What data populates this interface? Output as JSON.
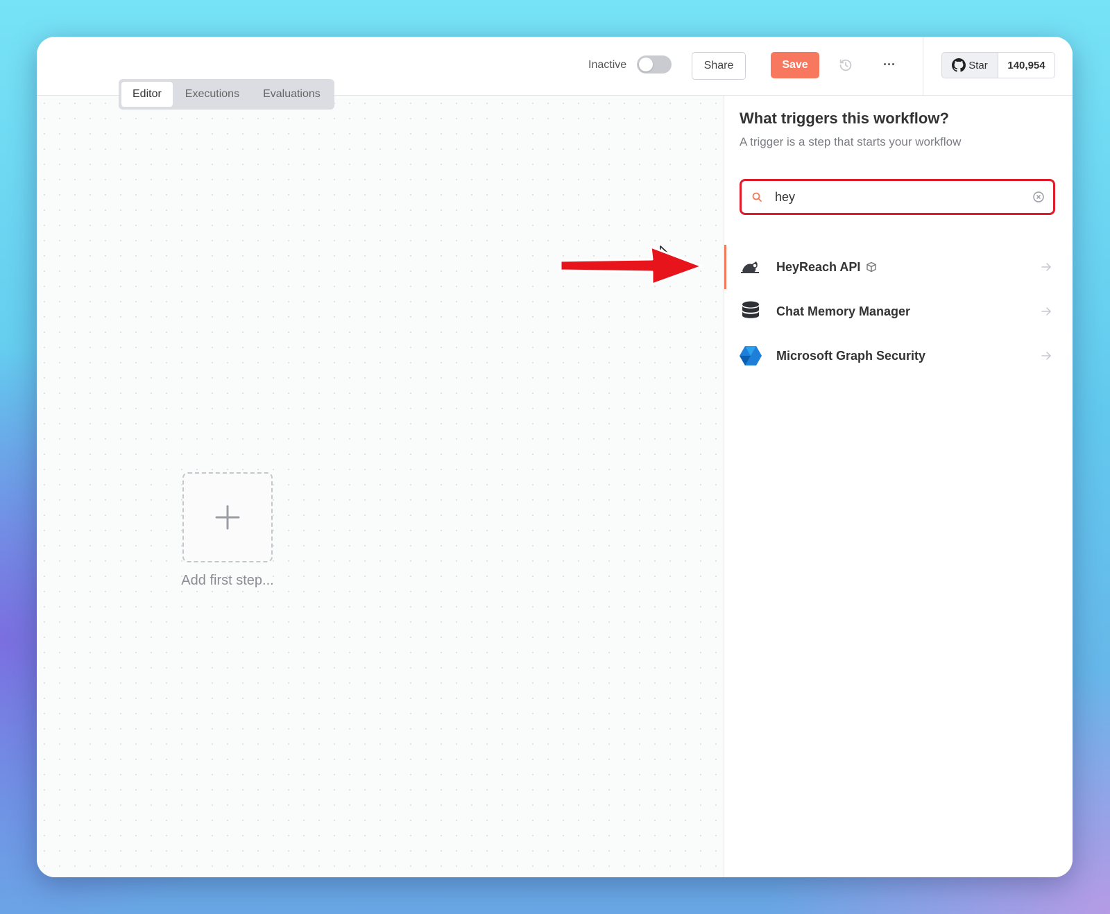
{
  "header": {
    "status_label": "Inactive",
    "share_label": "Share",
    "save_label": "Save",
    "github": {
      "star_label": "Star",
      "count": "140,954"
    }
  },
  "tabs": [
    {
      "label": "Editor",
      "active": true
    },
    {
      "label": "Executions",
      "active": false
    },
    {
      "label": "Evaluations",
      "active": false
    }
  ],
  "canvas": {
    "add_label": "Add first step..."
  },
  "panel": {
    "title": "What triggers this workflow?",
    "subtitle": "A trigger is a step that starts your workflow",
    "search": {
      "value": "hey",
      "placeholder": ""
    },
    "results": [
      {
        "label": "HeyReach API",
        "icon": "heyreach-icon",
        "badge": "cube-icon",
        "selected": true
      },
      {
        "label": "Chat Memory Manager",
        "icon": "database-icon",
        "selected": false
      },
      {
        "label": "Microsoft Graph Security",
        "icon": "microsoft-graph-icon",
        "selected": false
      }
    ]
  },
  "colors": {
    "accent": "#f7785e",
    "highlight": "#e01b2a",
    "annotation_arrow": "#e8141c"
  }
}
